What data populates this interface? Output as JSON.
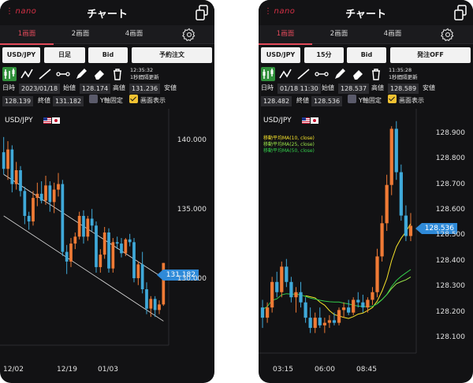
{
  "phones": [
    {
      "brand": "nano",
      "title": "チャート",
      "tabs": [
        "1画面",
        "2画面",
        "4画面"
      ],
      "active_tab": 0,
      "buttons": {
        "pair": "USD/JPY",
        "timeframe": "日足",
        "side": "Bid",
        "action": "予約注文"
      },
      "toolbar_time": "12:35:32",
      "toolbar_interval": "1秒間隔更新",
      "info": {
        "date_label": "日時",
        "date_value": "2023/01/18",
        "open_label": "始値",
        "open_value": "128.174",
        "high_label": "高値",
        "high_value": "131.236",
        "low_label": "安値",
        "low_value": "128.139",
        "close_label": "終値",
        "close_value": "131.182",
        "yfix_label": "Y軸固定",
        "show_label": "画面表示"
      },
      "chart_pair": "USD/JPY",
      "current_price": "131.182",
      "ma_legend": []
    },
    {
      "brand": "nano",
      "title": "チャート",
      "tabs": [
        "1画面",
        "2画面",
        "4画面"
      ],
      "active_tab": 0,
      "buttons": {
        "pair": "USD/JPY",
        "timeframe": "15分",
        "side": "Bid",
        "action": "発注OFF"
      },
      "toolbar_time": "11:35:28",
      "toolbar_interval": "1秒間隔更新",
      "info": {
        "date_label": "日時",
        "date_value": "01/18 11:30",
        "open_label": "始値",
        "open_value": "128.537",
        "high_label": "高値",
        "high_value": "128.589",
        "low_label": "安値",
        "low_value": "128.482",
        "close_label": "終値",
        "close_value": "128.536",
        "yfix_label": "Y軸固定",
        "show_label": "画面表示"
      },
      "chart_pair": "USD/JPY",
      "current_price": "128.536",
      "ma_legend": [
        "移動平均MA(10, close)",
        "移動平均MA(25, close)",
        "移動平均MA(50, close)"
      ]
    }
  ],
  "colors": {
    "up": "#ef7a35",
    "down": "#3fa9d9",
    "accent": "#e24a5a",
    "ma10": "#f5e22a",
    "ma25": "#9be64a",
    "ma50": "#33cc4a",
    "price_tag": "#2f8ad8"
  },
  "chart_data": [
    {
      "type": "candlestick",
      "title": "USD/JPY",
      "x_ticks": [
        "12/02",
        "12/19",
        "01/03"
      ],
      "y_ticks": [
        "140.000",
        "135.000",
        "130.000"
      ],
      "ylim": [
        125.6,
        142.0
      ],
      "candles": [
        {
          "o": 139.2,
          "h": 140.3,
          "l": 137.6,
          "c": 138.0
        },
        {
          "o": 138.0,
          "h": 140.0,
          "l": 137.2,
          "c": 139.4
        },
        {
          "o": 139.4,
          "h": 139.7,
          "l": 136.3,
          "c": 136.9
        },
        {
          "o": 136.9,
          "h": 138.5,
          "l": 136.5,
          "c": 137.9
        },
        {
          "o": 137.9,
          "h": 138.2,
          "l": 136.0,
          "c": 136.4
        },
        {
          "o": 136.4,
          "h": 136.7,
          "l": 134.0,
          "c": 134.6
        },
        {
          "o": 134.6,
          "h": 134.9,
          "l": 133.6,
          "c": 134.2
        },
        {
          "o": 134.2,
          "h": 136.4,
          "l": 133.9,
          "c": 135.9
        },
        {
          "o": 135.9,
          "h": 137.0,
          "l": 135.3,
          "c": 136.2
        },
        {
          "o": 136.2,
          "h": 137.1,
          "l": 135.5,
          "c": 135.7
        },
        {
          "o": 135.7,
          "h": 137.5,
          "l": 135.4,
          "c": 136.8
        },
        {
          "o": 136.8,
          "h": 137.1,
          "l": 134.9,
          "c": 135.6
        },
        {
          "o": 135.6,
          "h": 137.0,
          "l": 134.8,
          "c": 136.5
        },
        {
          "o": 136.5,
          "h": 137.7,
          "l": 136.0,
          "c": 136.9
        },
        {
          "o": 136.9,
          "h": 137.2,
          "l": 131.7,
          "c": 132.0
        },
        {
          "o": 132.0,
          "h": 132.5,
          "l": 130.4,
          "c": 131.3
        },
        {
          "o": 131.3,
          "h": 133.0,
          "l": 130.9,
          "c": 132.6
        },
        {
          "o": 132.6,
          "h": 133.4,
          "l": 132.2,
          "c": 133.1
        },
        {
          "o": 133.1,
          "h": 134.9,
          "l": 132.9,
          "c": 134.6
        },
        {
          "o": 134.6,
          "h": 135.0,
          "l": 132.6,
          "c": 133.1
        },
        {
          "o": 133.1,
          "h": 134.6,
          "l": 132.8,
          "c": 134.4
        },
        {
          "o": 134.4,
          "h": 135.1,
          "l": 133.5,
          "c": 133.9
        },
        {
          "o": 133.9,
          "h": 134.2,
          "l": 130.5,
          "c": 130.9
        },
        {
          "o": 130.9,
          "h": 132.2,
          "l": 130.5,
          "c": 131.8
        },
        {
          "o": 131.8,
          "h": 133.8,
          "l": 131.5,
          "c": 133.4
        },
        {
          "o": 133.4,
          "h": 133.7,
          "l": 130.5,
          "c": 130.8
        },
        {
          "o": 130.8,
          "h": 133.0,
          "l": 130.5,
          "c": 132.7
        },
        {
          "o": 132.7,
          "h": 133.1,
          "l": 132.2,
          "c": 132.6
        },
        {
          "o": 132.6,
          "h": 133.0,
          "l": 131.6,
          "c": 131.9
        },
        {
          "o": 131.9,
          "h": 133.0,
          "l": 131.7,
          "c": 132.9
        },
        {
          "o": 132.9,
          "h": 133.3,
          "l": 132.4,
          "c": 132.7
        },
        {
          "o": 132.7,
          "h": 133.0,
          "l": 129.8,
          "c": 130.1
        },
        {
          "o": 130.1,
          "h": 131.3,
          "l": 129.6,
          "c": 131.1
        },
        {
          "o": 131.1,
          "h": 132.0,
          "l": 129.0,
          "c": 129.3
        },
        {
          "o": 129.3,
          "h": 129.8,
          "l": 127.5,
          "c": 127.9
        },
        {
          "o": 127.9,
          "h": 128.8,
          "l": 127.3,
          "c": 128.6
        },
        {
          "o": 128.6,
          "h": 128.8,
          "l": 127.3,
          "c": 127.8
        },
        {
          "o": 127.8,
          "h": 128.5,
          "l": 127.5,
          "c": 128.2
        },
        {
          "o": 128.2,
          "h": 131.2,
          "l": 128.1,
          "c": 131.2
        }
      ],
      "trendlines": [
        {
          "from": [
            0,
            137.6
          ],
          "to": [
            38,
            130.1
          ]
        },
        {
          "from": [
            0,
            134.6
          ],
          "to": [
            38,
            127.0
          ]
        }
      ]
    },
    {
      "type": "candlestick",
      "title": "USD/JPY",
      "x_ticks": [
        "03:15",
        "06:00",
        "08:45"
      ],
      "y_ticks": [
        "128.900",
        "128.800",
        "128.700",
        "128.600",
        "128.500",
        "128.400",
        "128.300",
        "128.200",
        "128.100"
      ],
      "ylim": [
        128.06,
        128.98
      ],
      "series": [
        {
          "name": "移動平均MA(10, close)"
        },
        {
          "name": "移動平均MA(25, close)"
        },
        {
          "name": "移動平均MA(50, close)"
        }
      ],
      "candles": [
        {
          "o": 128.22,
          "h": 128.25,
          "l": 128.14,
          "c": 128.18
        },
        {
          "o": 128.18,
          "h": 128.24,
          "l": 128.16,
          "c": 128.22
        },
        {
          "o": 128.22,
          "h": 128.34,
          "l": 128.2,
          "c": 128.32
        },
        {
          "o": 128.32,
          "h": 128.36,
          "l": 128.26,
          "c": 128.28
        },
        {
          "o": 128.28,
          "h": 128.4,
          "l": 128.26,
          "c": 128.38
        },
        {
          "o": 128.38,
          "h": 128.41,
          "l": 128.3,
          "c": 128.32
        },
        {
          "o": 128.32,
          "h": 128.34,
          "l": 128.24,
          "c": 128.26
        },
        {
          "o": 128.26,
          "h": 128.3,
          "l": 128.2,
          "c": 128.28
        },
        {
          "o": 128.28,
          "h": 128.32,
          "l": 128.22,
          "c": 128.24
        },
        {
          "o": 128.24,
          "h": 128.26,
          "l": 128.16,
          "c": 128.18
        },
        {
          "o": 128.18,
          "h": 128.22,
          "l": 128.12,
          "c": 128.14
        },
        {
          "o": 128.14,
          "h": 128.2,
          "l": 128.12,
          "c": 128.18
        },
        {
          "o": 128.18,
          "h": 128.22,
          "l": 128.14,
          "c": 128.15
        },
        {
          "o": 128.15,
          "h": 128.18,
          "l": 128.12,
          "c": 128.16
        },
        {
          "o": 128.16,
          "h": 128.19,
          "l": 128.14,
          "c": 128.17
        },
        {
          "o": 128.17,
          "h": 128.2,
          "l": 128.15,
          "c": 128.16
        },
        {
          "o": 128.16,
          "h": 128.22,
          "l": 128.15,
          "c": 128.21
        },
        {
          "o": 128.21,
          "h": 128.24,
          "l": 128.18,
          "c": 128.22
        },
        {
          "o": 128.22,
          "h": 128.25,
          "l": 128.19,
          "c": 128.2
        },
        {
          "o": 128.2,
          "h": 128.26,
          "l": 128.19,
          "c": 128.25
        },
        {
          "o": 128.25,
          "h": 128.28,
          "l": 128.22,
          "c": 128.24
        },
        {
          "o": 128.24,
          "h": 128.27,
          "l": 128.2,
          "c": 128.22
        },
        {
          "o": 128.22,
          "h": 128.26,
          "l": 128.2,
          "c": 128.25
        },
        {
          "o": 128.25,
          "h": 128.3,
          "l": 128.23,
          "c": 128.28
        },
        {
          "o": 128.28,
          "h": 128.45,
          "l": 128.26,
          "c": 128.42
        },
        {
          "o": 128.42,
          "h": 128.58,
          "l": 128.4,
          "c": 128.55
        },
        {
          "o": 128.55,
          "h": 128.74,
          "l": 128.52,
          "c": 128.7
        },
        {
          "o": 128.7,
          "h": 128.93,
          "l": 128.66,
          "c": 128.92
        },
        {
          "o": 128.92,
          "h": 128.95,
          "l": 128.72,
          "c": 128.75
        },
        {
          "o": 128.75,
          "h": 128.78,
          "l": 128.56,
          "c": 128.58
        },
        {
          "o": 128.58,
          "h": 128.62,
          "l": 128.48,
          "c": 128.5
        },
        {
          "o": 128.5,
          "h": 128.59,
          "l": 128.48,
          "c": 128.54
        }
      ]
    }
  ]
}
